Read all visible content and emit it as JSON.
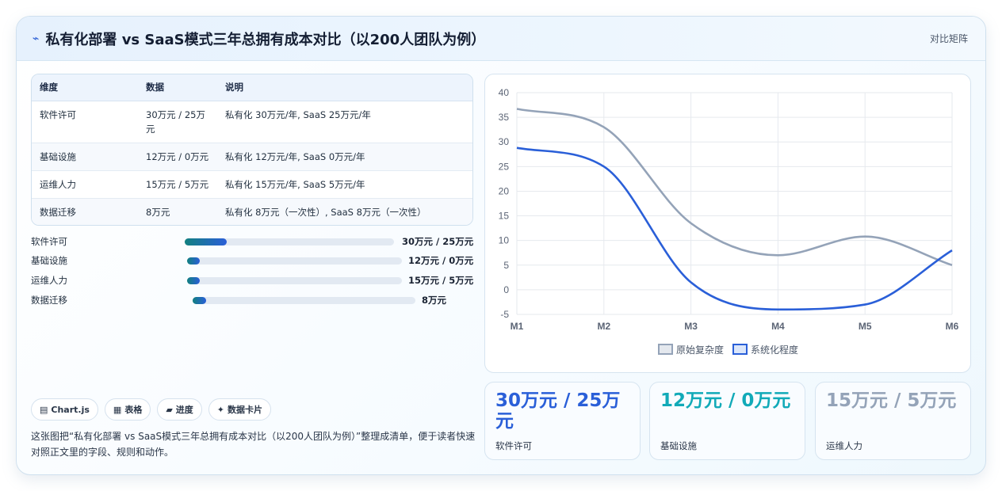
{
  "header": {
    "icon": "trend-icon",
    "title": "私有化部署 vs SaaS模式三年总拥有成本对比（以200人团队为例）",
    "tag": "对比矩阵"
  },
  "table": {
    "headers": [
      "维度",
      "数据",
      "说明"
    ],
    "rows": [
      [
        "软件许可",
        "30万元 / 25万元",
        "私有化 30万元/年, SaaS 25万元/年"
      ],
      [
        "基础设施",
        "12万元 / 0万元",
        "私有化 12万元/年, SaaS 0万元/年"
      ],
      [
        "运维人力",
        "15万元 / 5万元",
        "私有化 15万元/年, SaaS 5万元/年"
      ],
      [
        "数据迁移",
        "8万元",
        "私有化 8万元（一次性）, SaaS 8万元（一次性）"
      ]
    ]
  },
  "bars": [
    {
      "label": "软件许可",
      "value": "30万元 / 25万元",
      "fill": 0.2
    },
    {
      "label": "基础设施",
      "value": "12万元 / 0万元",
      "fill": 0.06
    },
    {
      "label": "运维人力",
      "value": "15万元 / 5万元",
      "fill": 0.06
    },
    {
      "label": "数据迁移",
      "value": "8万元",
      "fill": 0.06
    }
  ],
  "chips": [
    {
      "icon": "chart-icon",
      "glyph": "▤",
      "label": "Chart.js"
    },
    {
      "icon": "table-icon",
      "glyph": "▦",
      "label": "表格"
    },
    {
      "icon": "progress-icon",
      "glyph": "▰",
      "label": "进度"
    },
    {
      "icon": "sparkle-icon",
      "glyph": "✦",
      "label": "数据卡片"
    }
  ],
  "description": "这张图把“私有化部署 vs SaaS模式三年总拥有成本对比（以200人团队为例）”整理成清单，便于读者快速对照正文里的字段、规则和动作。",
  "chart_data": {
    "type": "line",
    "x": [
      "M1",
      "M2",
      "M3",
      "M4",
      "M5",
      "M6"
    ],
    "ylim": [
      -5,
      40
    ],
    "yticks": [
      -5,
      0,
      5,
      10,
      15,
      20,
      25,
      30,
      35,
      40
    ],
    "grid": true,
    "legend": "bottom",
    "series": [
      {
        "name": "原始复杂度",
        "color": "#94a3b8",
        "values": [
          36.7,
          33,
          13.5,
          7,
          10.8,
          5
        ]
      },
      {
        "name": "系统化程度",
        "color": "#2a5fd8",
        "values": [
          28.8,
          25,
          1.5,
          -4,
          -3,
          8
        ]
      }
    ]
  },
  "stats": [
    {
      "value": "30万元 / 25万元",
      "label": "软件许可",
      "color": "#2a5fd8"
    },
    {
      "value": "12万元 / 0万元",
      "label": "基础设施",
      "color": "#12aab8"
    },
    {
      "value": "15万元 / 5万元",
      "label": "运维人力",
      "color": "#94a3b8"
    }
  ]
}
